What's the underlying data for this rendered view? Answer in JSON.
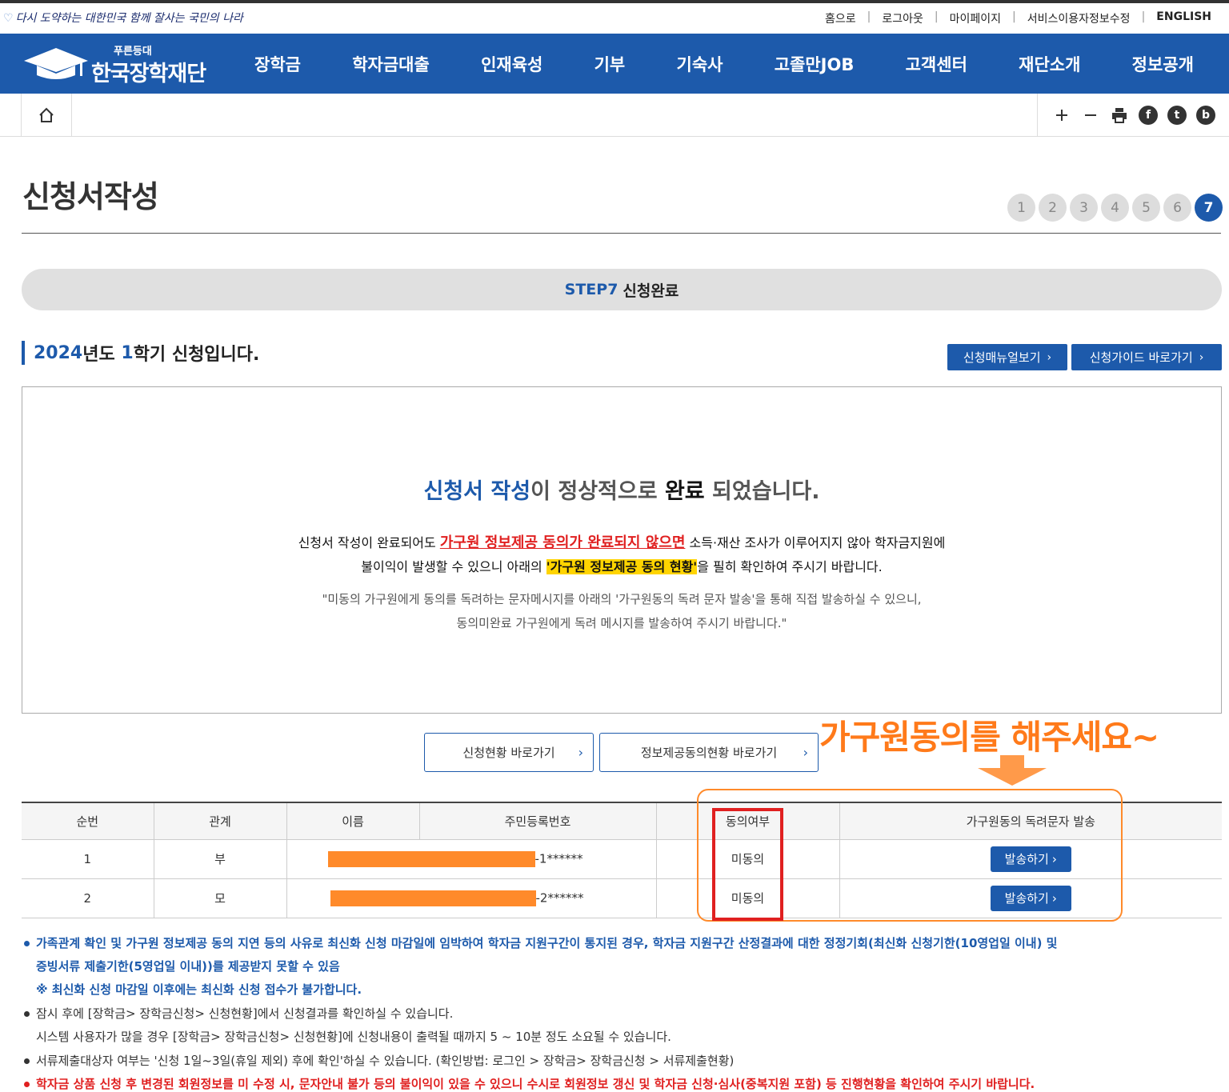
{
  "slogan": "다시 도약하는 대한민국 함께 잘사는 국민의 나라",
  "util_links": [
    "홈으로",
    "로그아웃",
    "마이페이지",
    "서비스이용자정보수정",
    "ENGLISH"
  ],
  "logo": {
    "sub": "푸른등대",
    "main": "한국장학재단"
  },
  "gnb": [
    "장학금",
    "학자금대출",
    "인재육성",
    "기부",
    "기숙사",
    "고졸만JOB",
    "고객센터",
    "재단소개",
    "정보공개"
  ],
  "page_title": "신청서작성",
  "steps": [
    "1",
    "2",
    "3",
    "4",
    "5",
    "6",
    "7"
  ],
  "active_step": 7,
  "step_bar": {
    "step": "STEP7",
    "label": "신청완료"
  },
  "semester": {
    "year": "2024",
    "year_suffix": "년도 ",
    "term": "1",
    "term_suffix": "학기 신청입니다."
  },
  "buttons": {
    "manual": "신청매뉴얼보기",
    "guide": "신청가이드 바로가기"
  },
  "done": {
    "title_part1": "신청서 작성",
    "title_part2": "이 정상적으로 ",
    "title_part3": "완료",
    "title_part4": " 되었습니다.",
    "notice1_a": "신청서 작성이 완료되어도 ",
    "notice1_red": "가구원 정보제공 동의가 완료되지 않으면",
    "notice1_b": " 소득·재산 조사가 이루어지지 않아 학자금지원에",
    "notice2_a": "불이익이 발생할 수 있으니 아래의 ",
    "notice2_hl": "'가구원 정보제공 동의 현황'",
    "notice2_b": "을 필히 확인하여 주시기 바랍니다.",
    "quote1": "\"미동의 가구원에게 동의를 독려하는 문자메시지를 아래의 '가구원동의 독려 문자 발송'을 통해 직접 발송하실 수 있으니,",
    "quote2": "동의미완료 가구원에게 독려 메시지를 발송하여 주시기 바랍니다.\""
  },
  "link_buttons": {
    "status": "신청현황 바로가기",
    "consent": "정보제공동의현황 바로가기"
  },
  "callout": "가구원동의를 해주세요~",
  "table": {
    "headers": [
      "순번",
      "관계",
      "이름",
      "주민등록번호",
      "동의여부",
      "가구원동의 독려문자 발송"
    ],
    "rows": [
      {
        "no": "1",
        "relation": "부",
        "id_suffix": "-1******",
        "consent": "미동의",
        "send": "발송하기"
      },
      {
        "no": "2",
        "relation": "모",
        "id_suffix": "-2******",
        "consent": "미동의",
        "send": "발송하기"
      }
    ]
  },
  "notes": {
    "n1_line1": "가족관계 확인 및 가구원 정보제공 동의 지연 등의 사유로 최신화 신청 마감일에 임박하여 학자금 지원구간이 통지된 경우, 학자금 지원구간 산정결과에 대한 정정기회(최신화 신청기한(10영업일 이내) 및",
    "n1_line2": "증빙서류 제출기한(5영업일 이내))를 제공받지 못할 수 있음",
    "n1_line3": "※ 최신화 신청 마감일 이후에는 최신화 신청 접수가 불가합니다.",
    "n2_line1": "잠시 후에 [장학금> 장학금신청> 신청현황]에서 신청결과를 확인하실 수 있습니다.",
    "n2_line2": "시스템 사용자가 많을 경우 [장학금> 장학금신청> 신청현황]에 신청내용이 출력될 때까지 5 ~ 10분 정도 소요될 수 있습니다.",
    "n3": "서류제출대상자 여부는 '신청 1일~3일(휴일 제외) 후에 확인'하실 수 있습니다. (확인방법: 로그인 > 장학금> 장학금신청 > 서류제출현황)",
    "n4": "학자금 상품 신청 후 변경된 회원정보를 미 수정 시, 문자안내 불가 등의 불이익이 있을 수 있으니 수시로 회원정보 갱신 및 학자금 신청·심사(중복지원 포함) 등 진행현황을 확인하여 주시기 바랍니다."
  },
  "colors": {
    "brand_blue": "#1d5aab",
    "alert_red": "#e02020",
    "highlight_yellow": "#ffd400",
    "annotation_orange": "#ff8a2a"
  }
}
